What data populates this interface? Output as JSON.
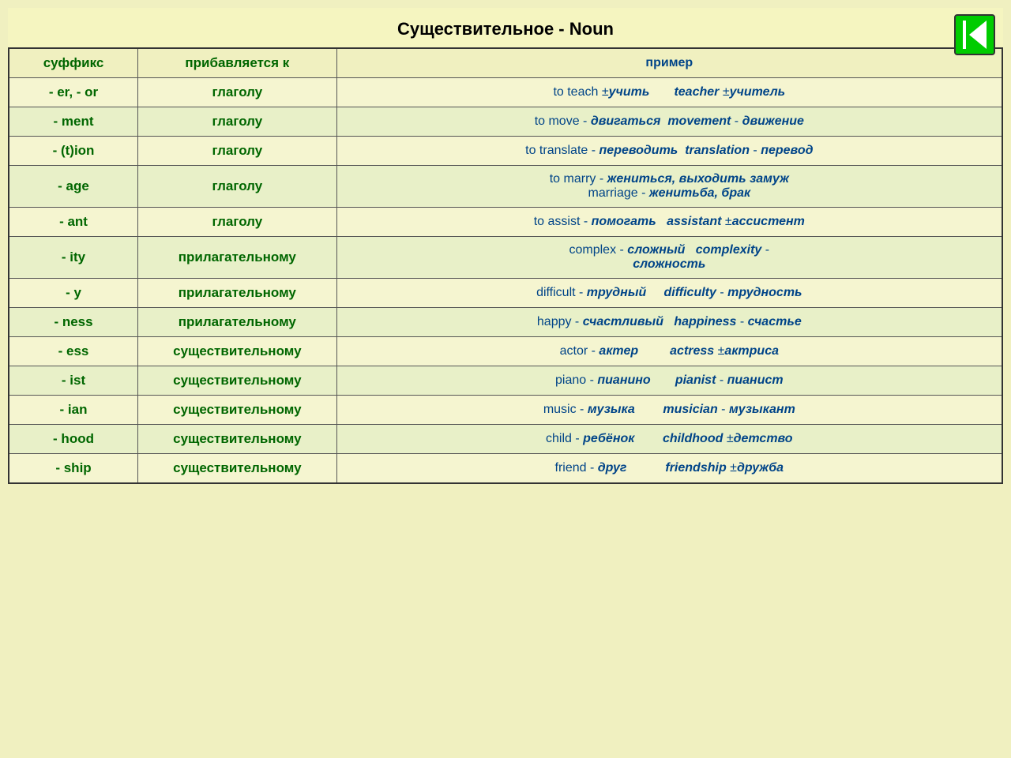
{
  "page": {
    "title": "Существительное - Noun",
    "nav_button": "◀|"
  },
  "table": {
    "headers": {
      "suffix": "суффикс",
      "added_to": "прибавляется к",
      "example": "пример"
    },
    "rows": [
      {
        "suffix": "- er, - or",
        "added_to": "глаголу",
        "example_html": "to teach ±<i><b>учить</b></i> &nbsp;&nbsp;&nbsp;&nbsp;&nbsp; <i><b>teacher</b></i> ±<i><b>учитель</b></i>"
      },
      {
        "suffix": "- ment",
        "added_to": "глаголу",
        "example_html": "to move - <i><b>двигаться</b></i> &nbsp;<i><b>movement</b></i> - <i><b>движение</b></i>"
      },
      {
        "suffix": "- (t)ion",
        "added_to": "глаголу",
        "example_html": "to translate - <i><b>переводить</b></i> &nbsp;<i><b>translation</b></i> - <i><b>перевод</b></i>"
      },
      {
        "suffix": "- age",
        "added_to": "глаголу",
        "example_html": "to marry - <i><b>жениться, выходить замуж</b></i><br>marriage - <i><b>женитьба, брак</b></i>"
      },
      {
        "suffix": "- ant",
        "added_to": "глаголу",
        "example_html": "to assist - <i><b>помогать</b></i> &nbsp;&nbsp;<i><b>assistant</b></i> ±<i><b>ассистент</b></i>"
      },
      {
        "suffix": "- ity",
        "added_to": "прилагательному",
        "example_html": "complex - <i><b>сложный</b></i> &nbsp;&nbsp;<i><b>complexity</b></i> -<br><i><b>сложность</b></i>"
      },
      {
        "suffix": "- y",
        "added_to": "прилагательному",
        "example_html": "difficult - <i><b>трудный</b></i> &nbsp;&nbsp;&nbsp;&nbsp;<i><b>difficulty</b></i> - <i><b>трудность</b></i>"
      },
      {
        "suffix": "- ness",
        "added_to": "прилагательному",
        "example_html": "happy - <i><b>счастливый</b></i> &nbsp;&nbsp;<i><b>happiness</b></i> - <i><b>счастье</b></i>"
      },
      {
        "suffix": "- ess",
        "added_to": "существительному",
        "example_html": "actor - <i><b>актер</b></i> &nbsp;&nbsp;&nbsp;&nbsp;&nbsp;&nbsp;&nbsp;&nbsp;<i><b>actress</b></i> ±<i><b>актриса</b></i>"
      },
      {
        "suffix": "- ist",
        "added_to": "существительному",
        "example_html": "piano - <i><b>пианино</b></i> &nbsp;&nbsp;&nbsp;&nbsp;&nbsp;&nbsp;<i><b>pianist</b></i> - <i><b>пианист</b></i>"
      },
      {
        "suffix": "- ian",
        "added_to": "существительному",
        "example_html": "music - <i><b>музыка</b></i> &nbsp;&nbsp;&nbsp;&nbsp;&nbsp;&nbsp;&nbsp;<i><b>musician</b></i> - <i><b>музыкант</b></i>"
      },
      {
        "suffix": "- hood",
        "added_to": "существительному",
        "example_html": "child - <i><b>ребёнок</b></i> &nbsp;&nbsp;&nbsp;&nbsp;&nbsp;&nbsp;&nbsp;<i><b>childhood</b></i> ±<i><b>детство</b></i>"
      },
      {
        "suffix": "- ship",
        "added_to": "существительному",
        "example_html": "friend - <i><b>друг</b></i> &nbsp;&nbsp;&nbsp;&nbsp;&nbsp;&nbsp;&nbsp;&nbsp;&nbsp;&nbsp;<i><b>friendship</b></i> ±<i><b>дружба</b></i>"
      }
    ]
  }
}
